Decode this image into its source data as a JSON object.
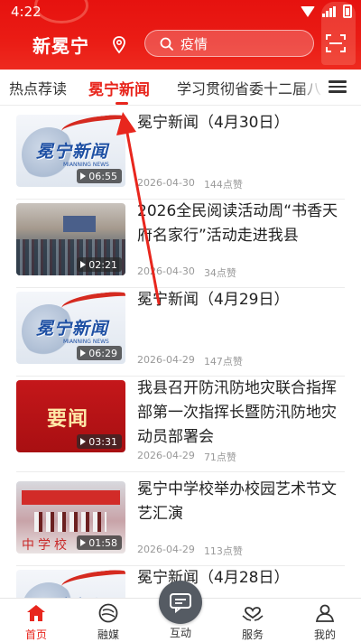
{
  "status_bar": {
    "time": "4:22"
  },
  "header": {
    "app_title": "新冕宁",
    "search": {
      "value": "疫情"
    }
  },
  "tabs": [
    {
      "label": "热点荐读",
      "active": false
    },
    {
      "label": "冕宁新闻",
      "active": true
    },
    {
      "label": "学习贯彻省委十二届八",
      "active": false
    }
  ],
  "news": [
    {
      "title": "冕宁新闻（4月30日）",
      "date": "2026-04-30",
      "likes": "144点赞",
      "duration": "06:55",
      "thumb": "news-logo"
    },
    {
      "title": "2026全民阅读活动周“书香天府名家行”活动走进我县",
      "date": "2026-04-30",
      "likes": "34点赞",
      "duration": "02:21",
      "thumb": "event-photo"
    },
    {
      "title": "冕宁新闻（4月29日）",
      "date": "2026-04-29",
      "likes": "147点赞",
      "duration": "06:29",
      "thumb": "news-logo"
    },
    {
      "title": "我县召开防汛防地灾联合指挥部第一次指挥长暨防汛防地灾动员部署会",
      "date": "2026-04-29",
      "likes": "71点赞",
      "duration": "03:31",
      "thumb": "red-banner"
    },
    {
      "title": "冕宁中学校举办校园艺术节文艺汇演",
      "date": "2026-04-29",
      "likes": "113点赞",
      "duration": "01:58",
      "thumb": "school-photo"
    },
    {
      "title": "冕宁新闻（4月28日）",
      "date": "",
      "likes": "",
      "duration": "",
      "thumb": "news-logo"
    }
  ],
  "thumb_text": {
    "news_logo": "冕宁新闻",
    "news_logo_en": "MIANNING NEWS",
    "red_banner": "要闻",
    "school_word": "中学校"
  },
  "bottom_nav": [
    {
      "label": "首页",
      "icon": "home-icon",
      "active": true
    },
    {
      "label": "融媒",
      "icon": "media-icon",
      "active": false
    },
    {
      "label": "互动",
      "icon": "chat-icon",
      "active": false
    },
    {
      "label": "服务",
      "icon": "service-icon",
      "active": false
    },
    {
      "label": "我的",
      "icon": "profile-icon",
      "active": false
    }
  ],
  "colors": {
    "brand_red": "#e8261d",
    "header_red": "#ea1c15"
  }
}
